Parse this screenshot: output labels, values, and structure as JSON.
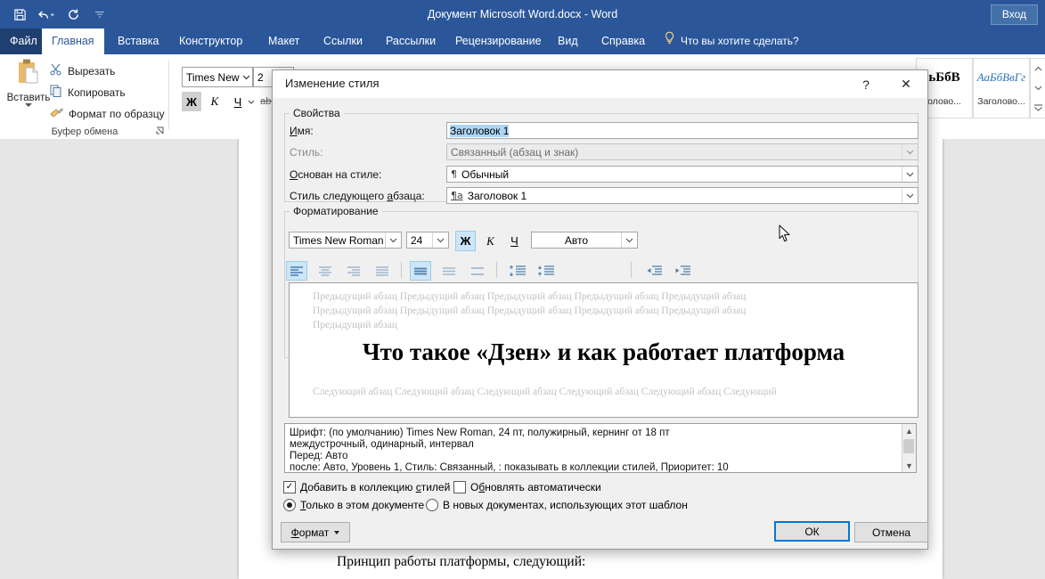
{
  "titlebar": {
    "document_title": "Документ Microsoft Word.docx  -  Word",
    "signin_label": "Вход",
    "qat": [
      {
        "name": "save-icon",
        "tooltip": "Сохранить"
      },
      {
        "name": "undo-icon",
        "tooltip": "Отменить"
      },
      {
        "name": "redo-icon",
        "tooltip": "Вернуть"
      },
      {
        "name": "customize-quick-access-toolbar-icon",
        "tooltip": "Настройка панели быстрого доступа"
      }
    ]
  },
  "ribbon": {
    "tabs": [
      {
        "label": "Файл",
        "active": false,
        "file": true
      },
      {
        "label": "Главная",
        "active": true
      },
      {
        "label": "Вставка",
        "active": false
      },
      {
        "label": "Конструктор",
        "active": false
      },
      {
        "label": "Макет",
        "active": false
      },
      {
        "label": "Ссылки",
        "active": false
      },
      {
        "label": "Рассылки",
        "active": false
      },
      {
        "label": "Рецензирование",
        "active": false
      },
      {
        "label": "Вид",
        "active": false
      },
      {
        "label": "Справка",
        "active": false
      }
    ],
    "tellme_placeholder": "Что вы хотите сделать?",
    "clipboard": {
      "group_label": "Буфер обмена",
      "paste_label": "Вставить",
      "items": [
        {
          "label": "Вырезать",
          "icon": "scissors-icon"
        },
        {
          "label": "Копировать",
          "icon": "copy-icon"
        },
        {
          "label": "Формат по образцу",
          "icon": "format-painter-icon"
        }
      ]
    },
    "font": {
      "family": "Times New R",
      "size": "2",
      "bold_label": "Ж",
      "italic_label": "К",
      "underline_label": "Ч",
      "strike_label": "abc"
    },
    "styles": [
      {
        "preview": "ьБбВ",
        "name": "олово..."
      },
      {
        "preview": "АаБбВвГг",
        "name": "Заголово..."
      }
    ]
  },
  "document": {
    "paragraph": "Принцип работы платформы, следующий:"
  },
  "dialog": {
    "title": "Изменение стиля",
    "help_label": "?",
    "close_label": "✕",
    "properties": {
      "group_label": "Свойства",
      "name_label": "Имя:",
      "name_value": "Заголовок 1",
      "style_label": "Стиль:",
      "style_value": "Связанный (абзац и знак)",
      "basedon_label": "Основан на стиле:",
      "basedon_value": "Обычный",
      "basedon_icon": "¶",
      "nextstyle_label": "Стиль следующего абзаца:",
      "nextstyle_value": "Заголовок 1",
      "nextstyle_icon": "¶a"
    },
    "formatting": {
      "group_label": "Форматирование",
      "font_family": "Times New Roman",
      "font_size": "24",
      "bold_label": "Ж",
      "italic_label": "К",
      "underline_label": "Ч",
      "color_value": "Авто",
      "bold_on": true,
      "align_buttons": [
        {
          "name": "align-left-icon",
          "selected": true
        },
        {
          "name": "align-center-icon",
          "selected": false
        },
        {
          "name": "align-right-icon",
          "selected": false
        },
        {
          "name": "align-justify-icon",
          "selected": false
        }
      ],
      "linespacing_buttons": [
        {
          "name": "line-spacing-single-icon",
          "selected": true
        },
        {
          "name": "line-spacing-1-5-icon",
          "selected": false
        },
        {
          "name": "line-spacing-double-icon",
          "selected": false
        }
      ],
      "paraspacing_buttons": [
        {
          "name": "increase-paragraph-spacing-icon",
          "selected": false
        },
        {
          "name": "decrease-paragraph-spacing-icon",
          "selected": false
        }
      ],
      "indent_buttons": [
        {
          "name": "decrease-indent-icon",
          "selected": false
        },
        {
          "name": "increase-indent-icon",
          "selected": false
        }
      ]
    },
    "preview": {
      "prev_lines": [
        "Предыдущий абзац Предыдущий абзац Предыдущий абзац Предыдущий абзац Предыдущий абзац",
        "Предыдущий абзац Предыдущий абзац Предыдущий абзац Предыдущий абзац Предыдущий абзац",
        "Предыдущий абзац"
      ],
      "heading": "Что такое «Дзен» и как работает платформа",
      "next_line": "Следующий абзац Следующий абзац Следующий абзац Следующий абзац Следующий абзац Следующий"
    },
    "description_lines": [
      "Шрифт: (по умолчанию) Times New Roman, 24 пт, полужирный, кернинг от 18 пт",
      "   междустрочный,  одинарный, интервал",
      "   Перед:  Авто",
      "   после: Авто, Уровень 1, Стиль: Связанный, : показывать в коллекции стилей, Приоритет: 10"
    ],
    "options": {
      "add_to_gallery_label": "Добавить в коллекцию стилей",
      "add_to_gallery_checked": true,
      "autoupdate_label": "Обновлять автоматически",
      "autoupdate_checked": false,
      "only_this_doc_label": "Только в этом документе",
      "only_this_doc_selected": true,
      "new_docs_label": "В новых документах, использующих этот шаблон",
      "new_docs_selected": false
    },
    "buttons": {
      "format_label": "Формат",
      "ok_label": "ОК",
      "cancel_label": "Отмена"
    }
  },
  "colors": {
    "word_blue": "#2b579a",
    "accent_blue": "#0078d7",
    "selection_blue": "#add6f5"
  }
}
